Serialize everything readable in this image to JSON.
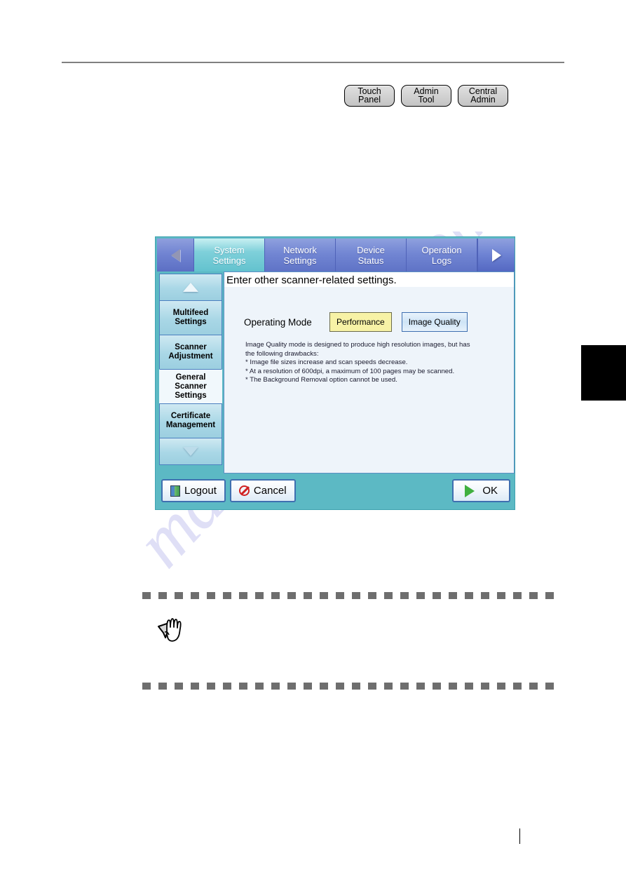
{
  "page": {
    "watermark": "manualshive.com"
  },
  "applies_to": {
    "buttons": [
      {
        "name": "touch-panel",
        "line1": "Touch",
        "line2": "Panel"
      },
      {
        "name": "admin-tool",
        "line1": "Admin",
        "line2": "Tool"
      },
      {
        "name": "central-admin",
        "line1": "Central",
        "line2": "Admin"
      }
    ]
  },
  "panel": {
    "nav": {
      "prev_icon": "triangle-left-icon",
      "next_icon": "triangle-right-icon",
      "tabs": [
        {
          "line1": "System",
          "line2": "Settings",
          "active": true
        },
        {
          "line1": "Network",
          "line2": "Settings",
          "active": false
        },
        {
          "line1": "Device",
          "line2": "Status",
          "active": false
        },
        {
          "line1": "Operation",
          "line2": "Logs",
          "active": false
        }
      ]
    },
    "sidebar": {
      "scroll_up_icon": "triangle-up-icon",
      "scroll_down_icon": "triangle-down-icon",
      "items": [
        {
          "line1": "Multifeed",
          "line2": "Settings",
          "line3": "",
          "selected": false
        },
        {
          "line1": "Scanner",
          "line2": "Adjustment",
          "line3": "",
          "selected": false
        },
        {
          "line1": "General",
          "line2": "Scanner",
          "line3": "Settings",
          "selected": true
        },
        {
          "line1": "Certificate",
          "line2": "Management",
          "line3": "",
          "selected": false
        }
      ]
    },
    "content": {
      "title": "Enter other scanner-related settings.",
      "operating_mode": {
        "label": "Operating Mode",
        "options": [
          {
            "label": "Performance",
            "selected": true
          },
          {
            "label": "Image Quality",
            "selected": false
          }
        ]
      },
      "description": [
        "Image Quality mode is designed to produce high resolution images, but has",
        "the following drawbacks:",
        "* Image file sizes increase and scan speeds decrease.",
        "* At a resolution of 600dpi, a maximum of 100 pages may be scanned.",
        "* The Background Removal option cannot be used."
      ]
    },
    "footer": {
      "logout": {
        "label": "Logout",
        "icon": "door-exit-icon"
      },
      "cancel": {
        "label": "Cancel",
        "icon": "prohibition-icon"
      },
      "ok": {
        "label": "OK",
        "icon": "green-play-triangle-icon"
      }
    }
  },
  "note": {
    "icon": "pointing-hand-icon",
    "text": ""
  },
  "colors": {
    "panel_frame": "#5cb9c4",
    "tab_active": "#7fd0da",
    "tab_inactive": "#7286d3",
    "content_bg": "#eef4fa",
    "sidebar_btn": "#a9d7e6",
    "option_selected": "#f7f2a6",
    "option_unselected": "#cfe4f6",
    "ok_icon_green": "#3fb03f",
    "cancel_icon_red": "#d02020",
    "rule_gray": "#808080",
    "dash_gray": "#6e6e6e",
    "watermark": "#9696e1"
  }
}
